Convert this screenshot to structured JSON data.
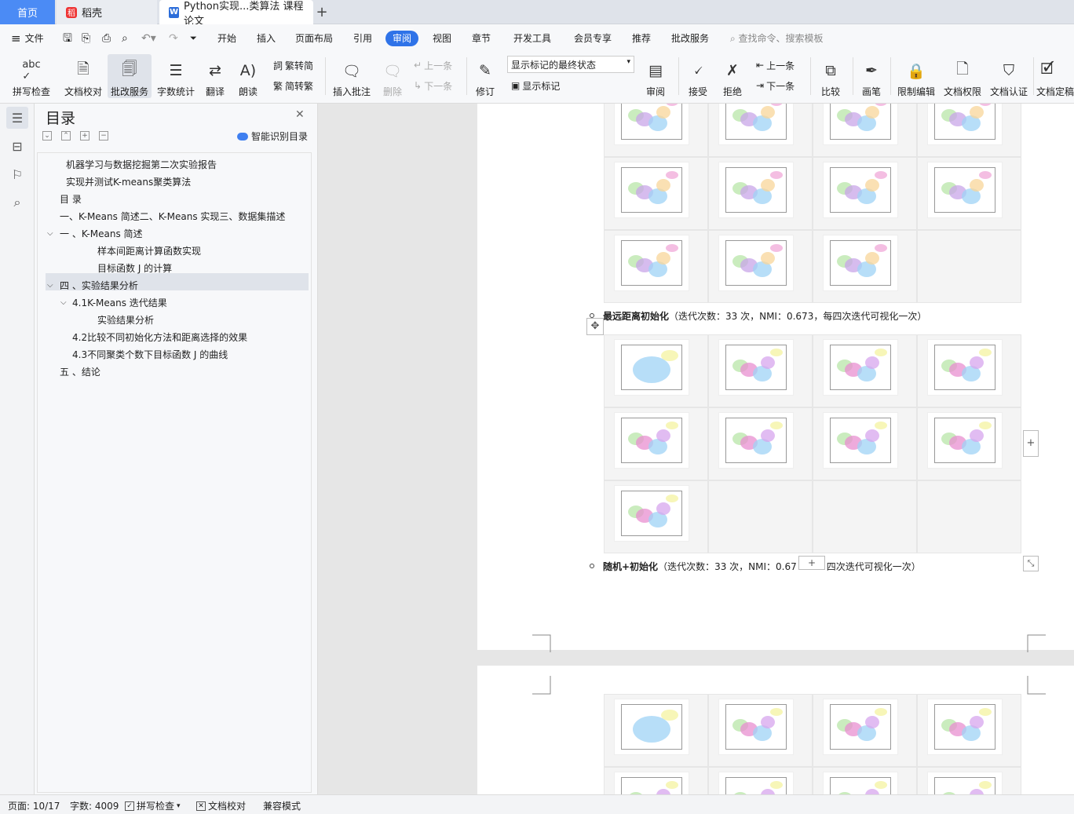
{
  "tabs": {
    "home": "首页",
    "daoke": "稻壳",
    "document": "Python实现...类算法 课程论文"
  },
  "menu": {
    "file": "文件",
    "items": [
      "开始",
      "插入",
      "页面布局",
      "引用",
      "审阅",
      "视图",
      "章节",
      "开发工具",
      "会员专享",
      "推荐",
      "批改服务"
    ],
    "search_placeholder": "查找命令、搜索模板"
  },
  "toolbar": {
    "spellcheck": "拼写检查",
    "doc_proof": "文档校对",
    "correction_service": "批改服务",
    "word_count": "字数统计",
    "translate": "翻译",
    "read_aloud": "朗读",
    "trad_to_simp": "繁转简",
    "simp_to_trad": "简转繁",
    "insert_comment": "插入批注",
    "delete": "删除",
    "prev_comment": "上一条",
    "next_comment": "下一条",
    "track_changes": "修订",
    "markup_mode": "显示标记的最终状态",
    "show_markup": "显示标记",
    "review": "审阅",
    "accept": "接受",
    "reject": "拒绝",
    "prev_change": "上一条",
    "next_change": "下一条",
    "compare": "比较",
    "pen": "画笔",
    "restrict_edit": "限制编辑",
    "doc_permission": "文档权限",
    "doc_certify": "文档认证",
    "doc_finalize": "文档定稿"
  },
  "toc": {
    "title": "目录",
    "smart_toc": "智能识别目录",
    "items": [
      "机器学习与数据挖掘第二次实验报告",
      "实现并测试K-means聚类算法",
      "目  录",
      "一、K-Means 简述二、K-Means 实现三、数据集描述",
      "一 、K-Means 简述",
      "样本间距离计算函数实现",
      "目标函数 J 的计算",
      "四 、实验结果分析",
      "4.1K-Means 迭代结果",
      "实验结果分析",
      "4.2比较不同初始化方法和距离选择的效果",
      "4.3不同聚类个数下目标函数 J 的曲线",
      "五 、结论"
    ]
  },
  "document": {
    "caption_far": {
      "bold": "最远距离初始化",
      "rest": "（迭代次数：33 次，NMI：0.673，每四次迭代可视化一次）"
    },
    "caption_random": {
      "bold": "随机+初始化",
      "rest": "（迭代次数：33 次，NMI：0.67",
      "rest2": "四次迭代可视化一次）"
    }
  },
  "status": {
    "page": "页面: 10/17",
    "words": "字数: 4009",
    "spellcheck": "拼写检查",
    "doc_proof": "文档校对",
    "compat_mode": "兼容模式"
  },
  "colors": {
    "accent": "#2f73e8",
    "tab_home": "#4b8bf5",
    "selection": "#dfe3ea"
  }
}
